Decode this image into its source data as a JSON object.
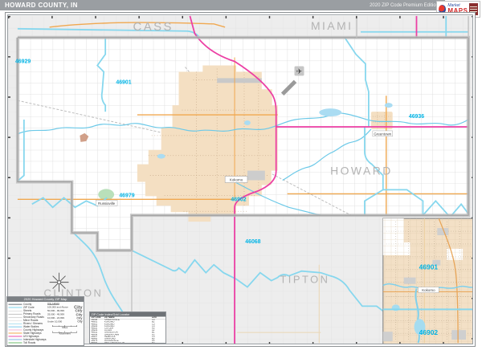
{
  "header": {
    "title": "HOWARD COUNTY, IN",
    "edition": "2020 ZIP Code Premium Edition"
  },
  "logo": {
    "script": "Market",
    "brand": "MAPS"
  },
  "map": {
    "county_labels": {
      "nw": "CASS",
      "ne": "MIAMI",
      "center": "HOWARD",
      "south": "TIPTON",
      "sw": "CLINTON"
    },
    "zip_labels": {
      "z46929": "46929",
      "z46901": "46901",
      "z46936": "46936",
      "z46979": "46979",
      "z46902": "46902",
      "z46068": "46068"
    },
    "town_labels": {
      "kokomo": "Kokomo",
      "greentown": "Greentown",
      "russiaville": "Russiaville"
    },
    "inset": {
      "zip_north": "46901",
      "zip_south": "46902",
      "town": "Kokomo"
    }
  },
  "legend": {
    "title": "2020 Howard County ZIP Map",
    "labels_title": "City Labels",
    "line_rows": [
      {
        "label": "County",
        "color": "#9aa0a4",
        "h": 3
      },
      {
        "label": "ZIP Code",
        "color": "#7fd8ef",
        "h": 2
      },
      {
        "label": "Streets",
        "color": "#c8c8c8",
        "h": 1
      },
      {
        "label": "Primary Roads",
        "color": "#8e8e8e",
        "h": 1
      },
      {
        "label": "Secondary Roads",
        "color": "#b5b5b5",
        "h": 1
      },
      {
        "label": "Minor Roads",
        "color": "#d8d8d8",
        "h": 1
      },
      {
        "label": "Rivers / Streams",
        "color": "#6cc9e8",
        "h": 1
      },
      {
        "label": "Water Bodies",
        "color": "#aadcf2",
        "h": 3
      },
      {
        "label": "County Highways",
        "color": "#f7b9d8",
        "h": 2
      },
      {
        "label": "State Highways",
        "color": "#f5a94f",
        "h": 2
      },
      {
        "label": "US Highways",
        "color": "#ee4fae",
        "h": 2
      },
      {
        "label": "Interstate Highways",
        "color": "#86b8e8",
        "h": 2
      },
      {
        "label": "Toll Roads",
        "color": "#6fc06f",
        "h": 2
      }
    ],
    "city_rows": [
      {
        "sample": "City",
        "size": 11,
        "label": "100,000 and Above"
      },
      {
        "sample": "City",
        "size": 9.5,
        "label": "50,000 - 99,999"
      },
      {
        "sample": "City",
        "size": 8.5,
        "label": "25,000 - 49,999"
      },
      {
        "sample": "City",
        "size": 7.5,
        "label": "10,000 - 24,999"
      },
      {
        "sample": "City",
        "size": 6.5,
        "label": "Under 10,000"
      }
    ],
    "scale_miles": "Miles",
    "scale_km": "Kilometers"
  },
  "table": {
    "title": "ZIP Code Index/Grid Locator",
    "headers": [
      "ZIP Code",
      "ZIP Name",
      "Grid"
    ],
    "rows": [
      [
        "46068",
        "SHARPSVILLE",
        "C4"
      ],
      [
        "46901",
        "KOKOMO",
        "B2"
      ],
      [
        "46902",
        "KOKOMO",
        "C3"
      ],
      [
        "46904",
        "KOKOMO",
        "C3"
      ],
      [
        "46920",
        "CUTLER",
        "A3"
      ],
      [
        "46929",
        "FLORA",
        "A2"
      ],
      [
        "46932",
        "GALVESTON",
        "B1"
      ],
      [
        "46936",
        "GREENTOWN",
        "D2"
      ],
      [
        "46937",
        "HEMLOCK",
        "C3"
      ],
      [
        "46965",
        "OAKFORD",
        "B3"
      ],
      [
        "46979",
        "RUSSIAVILLE",
        "A3"
      ],
      [
        "46995",
        "WEST MIDDLETON",
        "B3"
      ]
    ]
  },
  "colors": {
    "zip_boundary": "#86d7ee",
    "zip_label": "#00b4e6",
    "us_highway": "#ec3fa4",
    "state_road": "#f0a850",
    "water": "#6cc9e8",
    "urban_fill": "#f4dfc2",
    "outside_county": "#ededed",
    "county_line": "#b4b4b4"
  }
}
